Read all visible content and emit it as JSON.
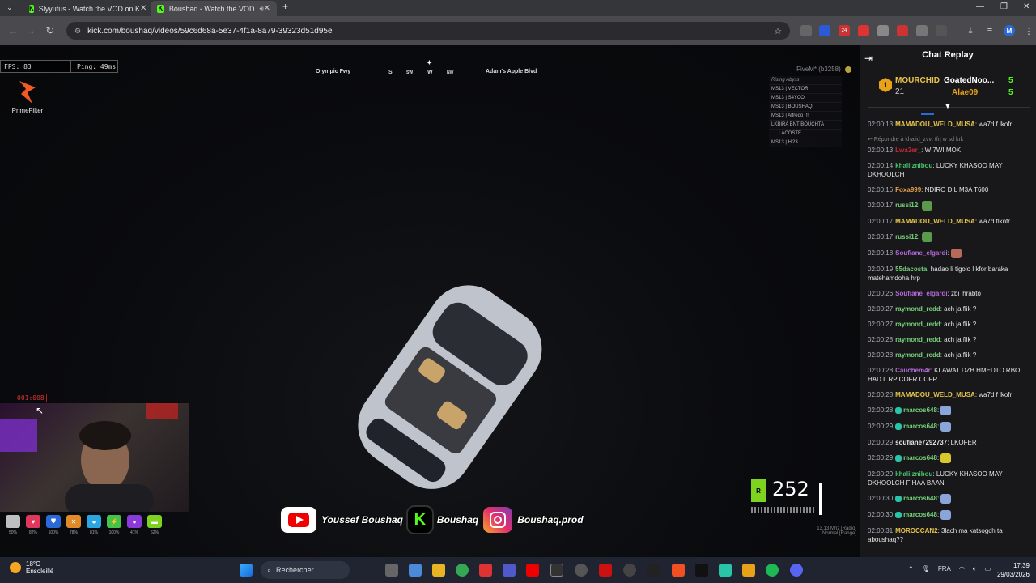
{
  "browser": {
    "tabs": [
      {
        "title": "Slyyutus - Watch the VOD on K"
      },
      {
        "title": "Boushaq - Watch the VOD"
      }
    ],
    "url": "kick.com/boushaq/videos/59c6d68a-5e37-4f1a-8a79-39323d51d95e",
    "ext_badges": {
      "b1": "24"
    }
  },
  "video": {
    "fps": "FPS: 83",
    "ping": "Ping: 49ms",
    "brand": "PrimeFilter",
    "compass": {
      "street_left": "Olympic Fwy",
      "street_right": "Adam's Apple Blvd",
      "dirs": [
        "S",
        "SW",
        "W",
        "NW"
      ]
    },
    "server": "FiveM* (b3258)",
    "players": [
      "Rising Abyss",
      "MS13 | VECTOR",
      "MS13 | S4YCO",
      "MS13 | BOUSHAQ",
      "MS13 | Alfredo !!!",
      "LKBIRA BNT BOUCHTA",
      "LACOSTE",
      "MS13 | H'23"
    ],
    "cam_timer": "001:008",
    "status": [
      {
        "pct": "50%",
        "color": "#bfbfbf",
        "icon": ""
      },
      {
        "pct": "82%",
        "color": "#e0385c",
        "icon": "♥"
      },
      {
        "pct": "100%",
        "color": "#2a6ad8",
        "icon": "⛊"
      },
      {
        "pct": "78%",
        "color": "#e08a2a",
        "icon": "✕"
      },
      {
        "pct": "81%",
        "color": "#2aa6e0",
        "icon": "●"
      },
      {
        "pct": "100%",
        "color": "#46c24a",
        "icon": "⚡"
      },
      {
        "pct": "41%",
        "color": "#8a3ad8",
        "icon": "●"
      },
      {
        "pct": "52%",
        "color": "#7ed321",
        "icon": "▬"
      }
    ],
    "socials": {
      "youtube": "Youssef Boushaq",
      "kick": "Boushaq",
      "instagram": "Boushaq.prod"
    },
    "speed": "252",
    "gear": "R",
    "radio_line1": "13.13 Mhz [Radio]",
    "radio_line2": "Normal [Range]"
  },
  "chat": {
    "title": "Chat Replay",
    "gifters": {
      "top_name": "MOURCHID",
      "top_count": "21",
      "second_name": "GoatedNoo...",
      "second_count": "5",
      "third_name": "Alae09",
      "third_count": "5"
    },
    "messages": [
      {
        "time": "02:00:13",
        "user": "MAMADOU_WELD_MUSA",
        "color": "#e8c54a",
        "text": ": wa7d f lkofr"
      },
      {
        "reply": "Répondre à khalid_zvv: tfrj w sd krk",
        "time": "02:00:13",
        "user": "Lwa3er_",
        "color": "#c12a3a",
        "text": ": W 7WI MOK"
      },
      {
        "time": "02:00:14",
        "user": "khalilznibou",
        "color": "#47c26a",
        "text": ": LUCKY KHASOO MAY DKHOOLCH"
      },
      {
        "time": "02:00:16",
        "user": "Foxa999",
        "color": "#e8a04a",
        "text": ": NDIRO DIL M3A T600"
      },
      {
        "time": "02:00:17",
        "user": "russi12",
        "color": "#75d17a",
        "text": ":",
        "emote": "#5a9a4a"
      },
      {
        "time": "02:00:17",
        "user": "MAMADOU_WELD_MUSA",
        "color": "#e8c54a",
        "text": ": wa7d flkofr"
      },
      {
        "time": "02:00:17",
        "user": "russi12",
        "color": "#75d17a",
        "text": ":",
        "emote": "#5a9a4a"
      },
      {
        "time": "02:00:18",
        "user": "Soufiane_elgardi",
        "color": "#b46ad8",
        "text": ":",
        "emote": "#b86a5a"
      },
      {
        "time": "02:00:19",
        "user": "55dacosta",
        "color": "#75d17a",
        "text": ": hadao li tigolo l kfor baraka matehamdoha hrp"
      },
      {
        "time": "02:00:26",
        "user": "Soufiane_elgardi",
        "color": "#b46ad8",
        "text": ": zbi lhrabto"
      },
      {
        "time": "02:00:27",
        "user": "raymond_redd",
        "color": "#75d17a",
        "text": ": ach ja flik ?"
      },
      {
        "time": "02:00:27",
        "user": "raymond_redd",
        "color": "#75d17a",
        "text": ": ach ja flik ?"
      },
      {
        "time": "02:00:28",
        "user": "raymond_redd",
        "color": "#75d17a",
        "text": ": ach ja flik ?"
      },
      {
        "time": "02:00:28",
        "user": "raymond_redd",
        "color": "#75d17a",
        "text": ": ach ja flik ?"
      },
      {
        "time": "02:00:28",
        "user": "Cauchem4r",
        "color": "#b46ad8",
        "text": ": KLAWAT DZB HMEDTO RBO HAD L RP COFR COFR"
      },
      {
        "time": "02:00:28",
        "user": "MAMADOU_WELD_MUSA",
        "color": "#e8c54a",
        "text": ": wa7d f lkofr"
      },
      {
        "time": "02:00:28",
        "user": "marcos648",
        "color": "#75d17a",
        "text": ":",
        "emote": "#8aa6d8",
        "badge": true
      },
      {
        "time": "02:00:29",
        "user": "marcos648",
        "color": "#75d17a",
        "text": ":",
        "emote": "#8aa6d8",
        "badge": true
      },
      {
        "time": "02:00:29",
        "user": "soufiane7292737",
        "color": "#e5e5e5",
        "text": ": LKOFER"
      },
      {
        "time": "02:00:29",
        "user": "marcos648",
        "color": "#75d17a",
        "text": ":",
        "emote": "#d8c82a",
        "badge": true
      },
      {
        "time": "02:00:29",
        "user": "khalilznibou",
        "color": "#47c26a",
        "text": ": LUCKY KHASOO MAY DKHOOLCH FIHAA BAAN"
      },
      {
        "time": "02:00:30",
        "user": "marcos648",
        "color": "#75d17a",
        "text": ":",
        "emote": "#8aa6d8",
        "badge": true
      },
      {
        "time": "02:00:30",
        "user": "marcos648",
        "color": "#75d17a",
        "text": ":",
        "emote": "#8aa6d8",
        "badge": true
      },
      {
        "time": "02:00:31",
        "user": "MOROCCAN2",
        "color": "#e8c54a",
        "text": ": 3lach ma katsogch ta aboushaq??"
      }
    ]
  },
  "taskbar": {
    "temp": "18°C",
    "weather": "Ensoleillé",
    "search": "Rechercher",
    "lang": "FRA",
    "time": "17:39",
    "date": "29/03/2026"
  }
}
